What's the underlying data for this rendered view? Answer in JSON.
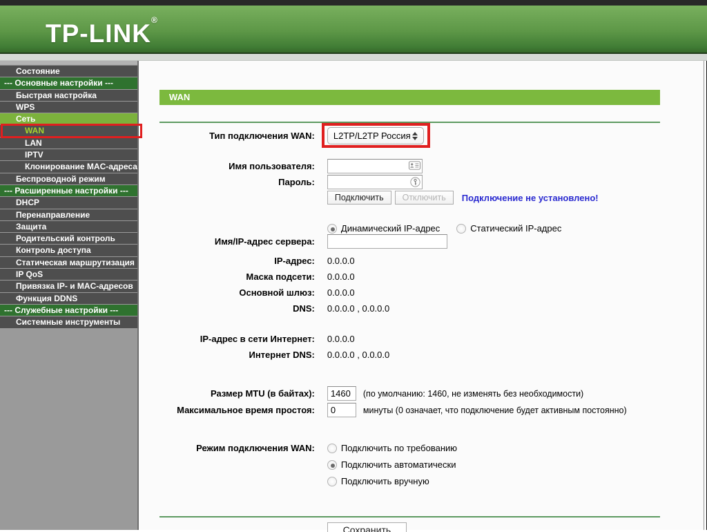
{
  "header": {
    "logo": "TP-LINK",
    "registered_mark": "®"
  },
  "sidebar": {
    "items": [
      {
        "label": "Состояние",
        "type": "item"
      },
      {
        "label": "--- Основные настройки ---",
        "type": "section"
      },
      {
        "label": "Быстрая настройка",
        "type": "item"
      },
      {
        "label": "WPS",
        "type": "item"
      },
      {
        "label": "Сеть",
        "type": "active-parent"
      },
      {
        "label": "WAN",
        "type": "active-sub",
        "annotated": true
      },
      {
        "label": "LAN",
        "type": "subitem"
      },
      {
        "label": "IPTV",
        "type": "subitem"
      },
      {
        "label": "Клонирование MAC-адреса",
        "type": "subitem"
      },
      {
        "label": "Беспроводной режим",
        "type": "item"
      },
      {
        "label": "--- Расширенные настройки ---",
        "type": "section"
      },
      {
        "label": "DHCP",
        "type": "item"
      },
      {
        "label": "Перенаправление",
        "type": "item"
      },
      {
        "label": "Защита",
        "type": "item"
      },
      {
        "label": "Родительский контроль",
        "type": "item"
      },
      {
        "label": "Контроль доступа",
        "type": "item"
      },
      {
        "label": "Статическая маршрутизация",
        "type": "item"
      },
      {
        "label": "IP QoS",
        "type": "item"
      },
      {
        "label": "Привязка IP- и MAC-адресов",
        "type": "item"
      },
      {
        "label": "Функция DDNS",
        "type": "item"
      },
      {
        "label": "--- Служебные настройки ---",
        "type": "section"
      },
      {
        "label": "Системные инструменты",
        "type": "item"
      }
    ]
  },
  "main": {
    "page_title": "WAN",
    "wan_type": {
      "label": "Тип подключения WAN:",
      "value": "L2TP/L2TP Россия"
    },
    "username": {
      "label": "Имя пользователя:",
      "value": ""
    },
    "password": {
      "label": "Пароль:",
      "value": ""
    },
    "connect_button": "Подключить",
    "disconnect_button": "Отключить",
    "disconnect_disabled": true,
    "status_text": "Подключение не установлено!",
    "ip_mode": {
      "dynamic_label": "Динамический IP-адрес",
      "static_label": "Статический IP-адрес",
      "dynamic_checked": true,
      "static_checked": false
    },
    "server": {
      "label": "Имя/IP-адрес сервера:",
      "value": ""
    },
    "info_rows": [
      {
        "label": "IP-адрес:",
        "value": "0.0.0.0"
      },
      {
        "label": "Маска подсети:",
        "value": "0.0.0.0"
      },
      {
        "label": "Основной шлюз:",
        "value": "0.0.0.0"
      },
      {
        "label": "DNS:",
        "value": "0.0.0.0 , 0.0.0.0"
      }
    ],
    "inet_rows": [
      {
        "label": "IP-адрес в сети Интернет:",
        "value": "0.0.0.0"
      },
      {
        "label": "Интернет DNS:",
        "value": "0.0.0.0 , 0.0.0.0"
      }
    ],
    "mtu": {
      "label": "Размер MTU (в байтах):",
      "value": "1460",
      "hint": "(по умолчанию: 1460, не изменять без необходимости)"
    },
    "idle": {
      "label": "Максимальное время простоя:",
      "value": "0",
      "hint": "минуты (0 означает, что подключение будет активным постоянно)"
    },
    "wan_mode": {
      "label": "Режим подключения WAN:",
      "options": [
        {
          "label": "Подключить по требованию",
          "checked": false
        },
        {
          "label": "Подключить автоматически",
          "checked": true
        },
        {
          "label": "Подключить вручную",
          "checked": false
        }
      ]
    },
    "save_button": "Сохранить"
  },
  "colors": {
    "header_green": "#5d9747",
    "page_bar_green": "#7cb93e",
    "section_green": "#2f722f",
    "active_item_green": "#7cb23c",
    "active_link_green": "#a6d32d",
    "annotation_red": "#e01f1f",
    "status_blue": "#2a2ad0"
  }
}
